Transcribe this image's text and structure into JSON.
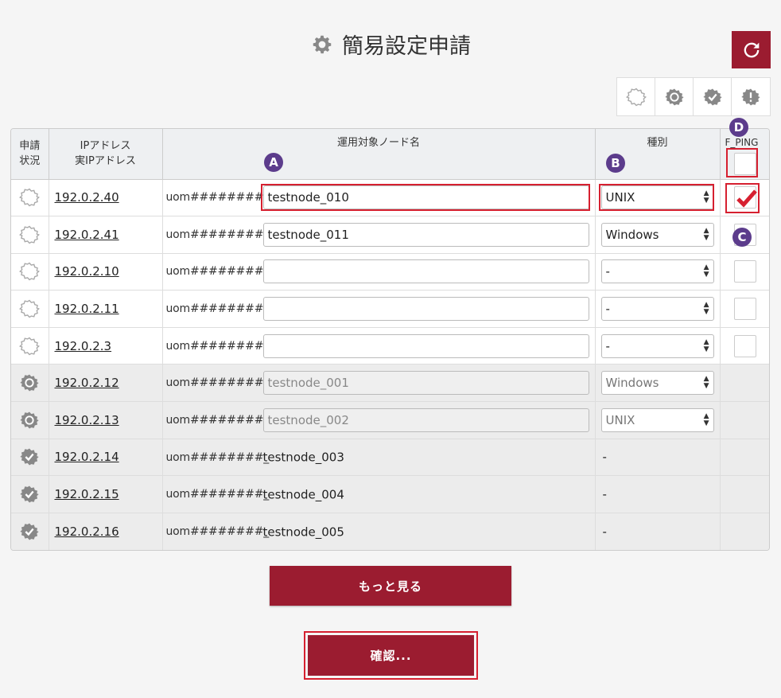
{
  "page": {
    "title": "簡易設定申請"
  },
  "toolbar": {
    "refresh_icon": "refresh-icon",
    "filters": [
      "gear-outline-icon",
      "gear-sync-icon",
      "gear-check-icon",
      "gear-alert-icon"
    ]
  },
  "table": {
    "headers": {
      "status_line1": "申請",
      "status_line2": "状況",
      "ip_line1": "IPアドレス",
      "ip_line2": "実IPアドレス",
      "node": "運用対象ノード名",
      "type": "種別",
      "ping": "F_PING"
    },
    "rows": [
      {
        "status": "outline",
        "ip": "192.0.2.40",
        "prefix": "uom########_",
        "node": "testnode_010",
        "type": "UNIX",
        "checked": true
      },
      {
        "status": "outline",
        "ip": "192.0.2.41",
        "prefix": "uom########_",
        "node": "testnode_011",
        "type": "Windows",
        "checked": false
      },
      {
        "status": "outline",
        "ip": "192.0.2.10",
        "prefix": "uom########_",
        "node": "",
        "type": "-",
        "checked": false
      },
      {
        "status": "outline",
        "ip": "192.0.2.11",
        "prefix": "uom########_",
        "node": "",
        "type": "-",
        "checked": false
      },
      {
        "status": "outline",
        "ip": "192.0.2.3",
        "prefix": "uom########_",
        "node": "",
        "type": "-",
        "checked": false
      },
      {
        "status": "sync",
        "ip": "192.0.2.12",
        "prefix": "uom########_",
        "node": "testnode_001",
        "type": "Windows"
      },
      {
        "status": "sync",
        "ip": "192.0.2.13",
        "prefix": "uom########_",
        "node": "testnode_002",
        "type": "UNIX"
      },
      {
        "status": "check",
        "ip": "192.0.2.14",
        "prefix": "uom########_",
        "node": "testnode_003",
        "type": "-"
      },
      {
        "status": "check",
        "ip": "192.0.2.15",
        "prefix": "uom########_",
        "node": "testnode_004",
        "type": "-"
      },
      {
        "status": "check",
        "ip": "192.0.2.16",
        "prefix": "uom########_",
        "node": "testnode_005",
        "type": "-"
      }
    ]
  },
  "annotations": {
    "a": "A",
    "b": "B",
    "c": "C",
    "d": "D"
  },
  "buttons": {
    "more": "もっと見る",
    "confirm": "確認..."
  },
  "colors": {
    "accent": "#9b1c30",
    "highlight": "#d62030",
    "marker": "#5c3c8c"
  }
}
